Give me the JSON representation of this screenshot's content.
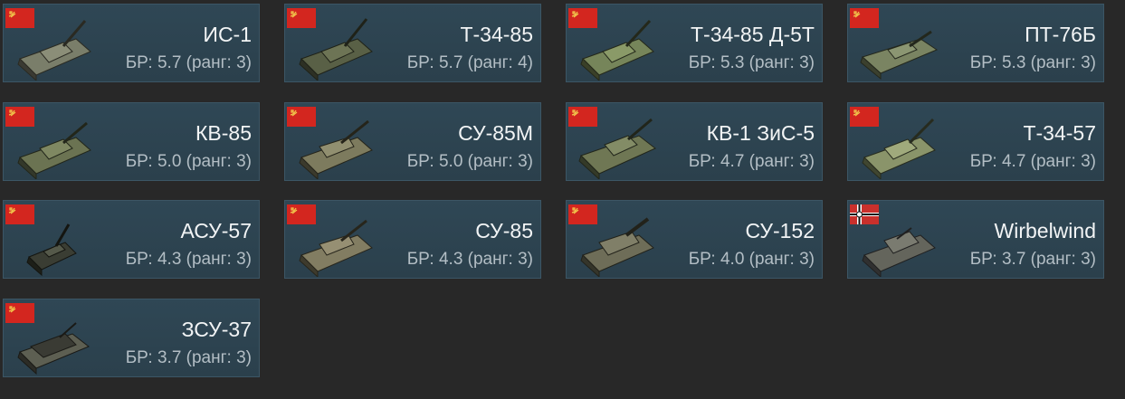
{
  "vehicles": [
    {
      "name": "ИС-1",
      "br": "БР: 5.7 (ранг: 3)",
      "nation": "ussr"
    },
    {
      "name": "Т-34-85",
      "br": "БР: 5.7 (ранг: 4)",
      "nation": "ussr"
    },
    {
      "name": "Т-34-85 Д-5Т",
      "br": "БР: 5.3 (ранг: 3)",
      "nation": "ussr"
    },
    {
      "name": "ПТ-76Б",
      "br": "БР: 5.3 (ранг: 3)",
      "nation": "ussr"
    },
    {
      "name": "КВ-85",
      "br": "БР: 5.0 (ранг: 3)",
      "nation": "ussr"
    },
    {
      "name": "СУ-85М",
      "br": "БР: 5.0 (ранг: 3)",
      "nation": "ussr"
    },
    {
      "name": "КВ-1 ЗиС-5",
      "br": "БР: 4.7 (ранг: 3)",
      "nation": "ussr"
    },
    {
      "name": "Т-34-57",
      "br": "БР: 4.7 (ранг: 3)",
      "nation": "ussr"
    },
    {
      "name": "АСУ-57",
      "br": "БР: 4.3 (ранг: 3)",
      "nation": "ussr"
    },
    {
      "name": "СУ-85",
      "br": "БР: 4.3 (ранг: 3)",
      "nation": "ussr"
    },
    {
      "name": "СУ-152",
      "br": "БР: 4.0 (ранг: 3)",
      "nation": "ussr"
    },
    {
      "name": "Wirbelwind",
      "br": "БР: 3.7 (ранг: 3)",
      "nation": "germany"
    },
    {
      "name": "ЗСУ-37",
      "br": "БР: 3.7 (ранг: 3)",
      "nation": "ussr"
    }
  ],
  "colors": {
    "background": "#282828",
    "card": "#2f4755",
    "card_border": "#3c5665",
    "name_text": "#f2f4f5",
    "br_text": "#b3bec5",
    "ussr_flag": "#d3261f",
    "tank_green": "#6e7a4e"
  }
}
